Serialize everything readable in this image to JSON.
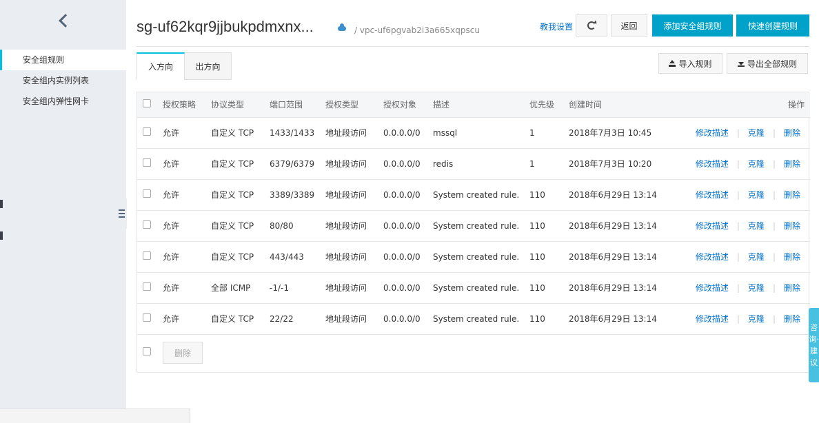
{
  "sidebar": {
    "items": [
      {
        "label": "安全组规则",
        "active": true
      },
      {
        "label": "安全组内实例列表",
        "active": false
      },
      {
        "label": "安全组内弹性网卡",
        "active": false
      }
    ]
  },
  "header": {
    "title": "sg-uf62kqr9jjbukpdmxnx...",
    "vpc_path": "/ vpc-uf6pgvab2i3a665xqpscu",
    "help_link": "教我设置",
    "back_label": "返回",
    "add_rule_label": "添加安全组规则",
    "quick_create_label": "快速创建规则"
  },
  "tabs": [
    {
      "label": "入方向",
      "active": true
    },
    {
      "label": "出方向",
      "active": false
    }
  ],
  "actions": {
    "import_label": "导入规则",
    "export_label": "导出全部规则"
  },
  "table": {
    "headers": [
      "授权策略",
      "协议类型",
      "端口范围",
      "授权类型",
      "授权对象",
      "描述",
      "优先级",
      "创建时间",
      "操作"
    ],
    "rows": [
      {
        "policy": "允许",
        "protocol": "自定义 TCP",
        "port": "1433/1433",
        "auth_type": "地址段访问",
        "auth_obj": "0.0.0.0/0",
        "desc": "mssql",
        "priority": "1",
        "created": "2018年7月3日 10:45"
      },
      {
        "policy": "允许",
        "protocol": "自定义 TCP",
        "port": "6379/6379",
        "auth_type": "地址段访问",
        "auth_obj": "0.0.0.0/0",
        "desc": "redis",
        "priority": "1",
        "created": "2018年7月3日 10:20"
      },
      {
        "policy": "允许",
        "protocol": "自定义 TCP",
        "port": "3389/3389",
        "auth_type": "地址段访问",
        "auth_obj": "0.0.0.0/0",
        "desc": "System created rule.",
        "priority": "110",
        "created": "2018年6月29日 13:14"
      },
      {
        "policy": "允许",
        "protocol": "自定义 TCP",
        "port": "80/80",
        "auth_type": "地址段访问",
        "auth_obj": "0.0.0.0/0",
        "desc": "System created rule.",
        "priority": "110",
        "created": "2018年6月29日 13:14"
      },
      {
        "policy": "允许",
        "protocol": "自定义 TCP",
        "port": "443/443",
        "auth_type": "地址段访问",
        "auth_obj": "0.0.0.0/0",
        "desc": "System created rule.",
        "priority": "110",
        "created": "2018年6月29日 13:14"
      },
      {
        "policy": "允许",
        "protocol": "全部 ICMP",
        "port": "-1/-1",
        "auth_type": "地址段访问",
        "auth_obj": "0.0.0.0/0",
        "desc": "System created rule.",
        "priority": "110",
        "created": "2018年6月29日 13:14"
      },
      {
        "policy": "允许",
        "protocol": "自定义 TCP",
        "port": "22/22",
        "auth_type": "地址段访问",
        "auth_obj": "0.0.0.0/0",
        "desc": "System created rule.",
        "priority": "110",
        "created": "2018年6月29日 13:14"
      }
    ],
    "op_edit": "修改描述",
    "op_clone": "克隆",
    "op_delete": "删除",
    "bulk_delete_label": "删除"
  },
  "consult": {
    "label": "咨询·建议"
  },
  "colors": {
    "accent": "#00c1de",
    "primary_button": "#00a2ca",
    "link": "#0070cc",
    "sidebar_bg": "#eaedf1"
  }
}
